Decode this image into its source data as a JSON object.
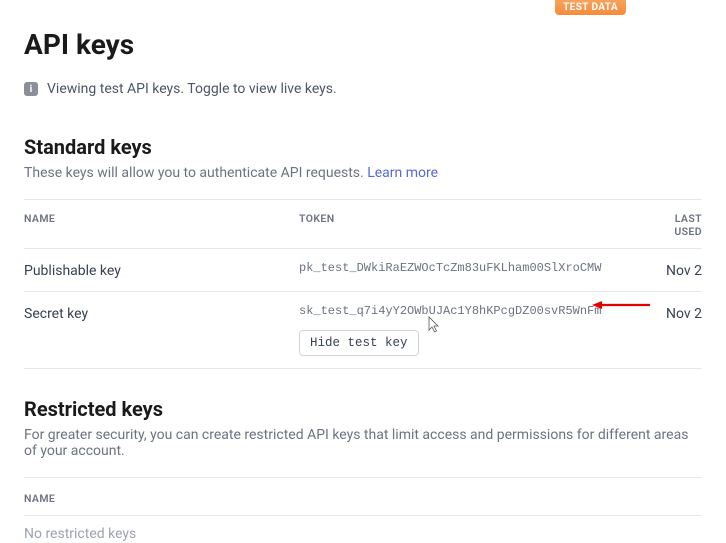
{
  "badge": {
    "label": "TEST DATA"
  },
  "page": {
    "title": "API keys",
    "info": "Viewing test API keys. Toggle to view live keys."
  },
  "standard": {
    "title": "Standard keys",
    "desc_prefix": "These keys will allow you to authenticate API requests. ",
    "learn_more": "Learn more",
    "columns": {
      "name": "NAME",
      "token": "TOKEN",
      "last_used": "LAST USED"
    },
    "rows": [
      {
        "name": "Publishable key",
        "token": "pk_test_DWkiRaEZWOcTcZm83uFKLham00SlXroCMW",
        "last_used": "Nov 2"
      },
      {
        "name": "Secret key",
        "token": "sk_test_q7i4yY2OWbUJAc1Y8hKPcgDZ00svR5WnFm",
        "last_used": "Nov 2"
      }
    ],
    "hide_label": "Hide test key"
  },
  "restricted": {
    "title": "Restricted keys",
    "desc": "For greater security, you can create restricted API keys that limit access and permissions for different areas of your account.",
    "columns": {
      "name": "NAME"
    },
    "empty": "No restricted keys"
  }
}
